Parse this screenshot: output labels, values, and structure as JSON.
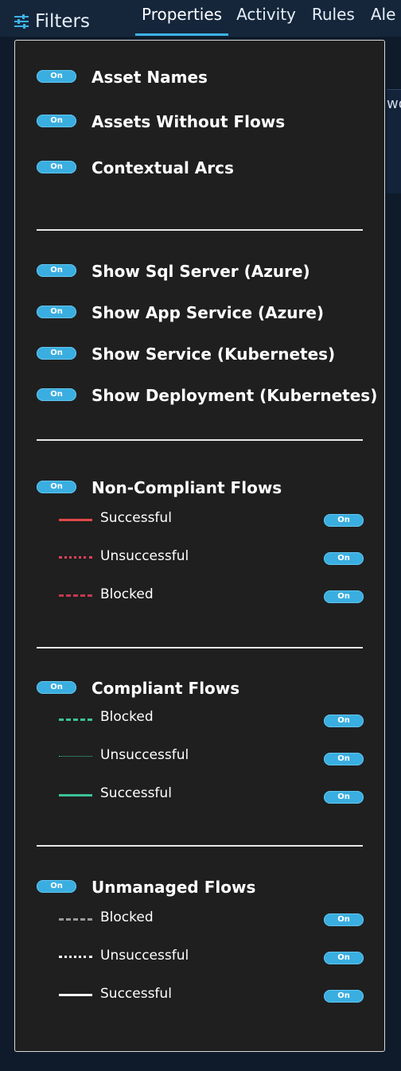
{
  "header": {
    "filters_label": "Filters",
    "tabs": [
      {
        "label": "Properties",
        "active": true
      },
      {
        "label": "Activity"
      },
      {
        "label": "Rules"
      },
      {
        "label": "Ale"
      }
    ],
    "bg_text": "wo"
  },
  "toggle_label": "On",
  "general": [
    {
      "label": "Asset Names",
      "state": "On"
    },
    {
      "label": "Assets Without Flows",
      "state": "On"
    },
    {
      "label": "Contextual Arcs",
      "state": "On"
    }
  ],
  "show": [
    {
      "label": "Show Sql Server (Azure)",
      "state": "On"
    },
    {
      "label": "Show App Service (Azure)",
      "state": "On"
    },
    {
      "label": "Show Service (Kubernetes)",
      "state": "On"
    },
    {
      "label": "Show Deployment (Kubernetes)",
      "state": "On"
    }
  ],
  "non_compliant": {
    "label": "Non-Compliant Flows",
    "state": "On",
    "items": [
      {
        "label": "Successful",
        "state": "On",
        "style": "solid",
        "color": "#e04848"
      },
      {
        "label": "Unsuccessful",
        "state": "On",
        "style": "dotted",
        "color": "#e0405a"
      },
      {
        "label": "Blocked",
        "state": "On",
        "style": "dashed",
        "color": "#c7384e"
      }
    ]
  },
  "compliant": {
    "label": "Compliant Flows",
    "state": "On",
    "items": [
      {
        "label": "Blocked",
        "state": "On",
        "style": "dashed",
        "color": "#3cc29a"
      },
      {
        "label": "Unsuccessful",
        "state": "On",
        "style": "dotted",
        "color": "#3cc29a"
      },
      {
        "label": "Successful",
        "state": "On",
        "style": "solid",
        "color": "#3cc29a"
      }
    ]
  },
  "unmanaged": {
    "label": "Unmanaged Flows",
    "state": "On",
    "items": [
      {
        "label": "Blocked",
        "state": "On",
        "style": "dashed",
        "color": "#9a9a9a"
      },
      {
        "label": "Unsuccessful",
        "state": "On",
        "style": "dotted",
        "color": "#ffffff"
      },
      {
        "label": "Successful",
        "state": "On",
        "style": "solid",
        "color": "#ffffff"
      }
    ]
  },
  "colors": {
    "toggle": "#3aaee0",
    "panel": "#1f1f1f",
    "accent": "#3cb3e6"
  }
}
